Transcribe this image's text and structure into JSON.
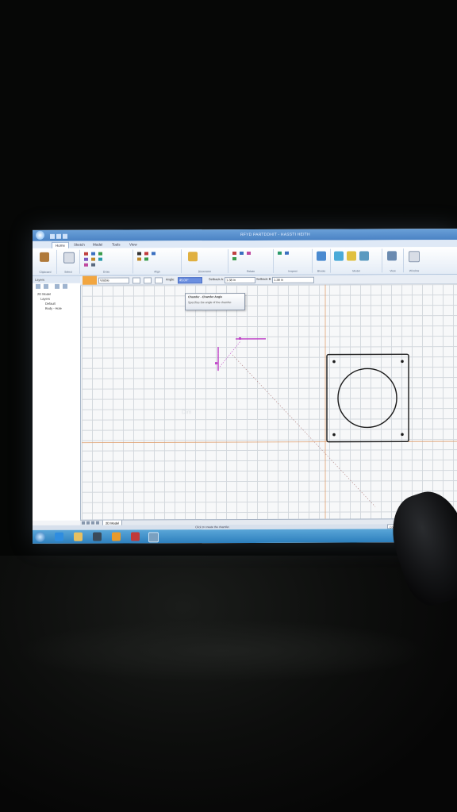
{
  "window": {
    "title": "RFYD PARTDDHIT - HASSTI HEITH"
  },
  "ribbon": {
    "tabs": [
      "Home",
      "Sketch",
      "Model",
      "Tools",
      "View"
    ],
    "active_tab": "Home",
    "groups": [
      "Clipboard",
      "Select",
      "Draw",
      "Align",
      "Dimension",
      "Relate",
      "Inspect",
      "Blocks",
      "Model",
      "View",
      "Window"
    ]
  },
  "options_bar": {
    "layer_value": "Visible",
    "angle_label": "Angle:",
    "angle_value": "45.00°",
    "setback_a_label": "Setback A:",
    "setback_a_value": "1.38 in",
    "setback_b_label": "Setback B:",
    "setback_b_value": "1.38 in"
  },
  "tooltip": {
    "title": "Chamfer - Chamfer Angle",
    "description": "Specifies the angle of the chamfer."
  },
  "sidebar": {
    "header": "Layers",
    "tree": [
      "2D Model",
      "Layers",
      "Default",
      "Body - Hole"
    ]
  },
  "canvas": {
    "watermark": "Dim"
  },
  "bottom_tabs": {
    "model_tab": "2D Model"
  },
  "statusbar": {
    "text": "Click to create the chamfer.",
    "command_box": "Command"
  },
  "colors": {
    "accent_magenta": "#c048c8",
    "drawing_black": "#1b1b1b",
    "axis_orange": "#e0a070",
    "taskbar_blue": "#2d7fbd"
  }
}
